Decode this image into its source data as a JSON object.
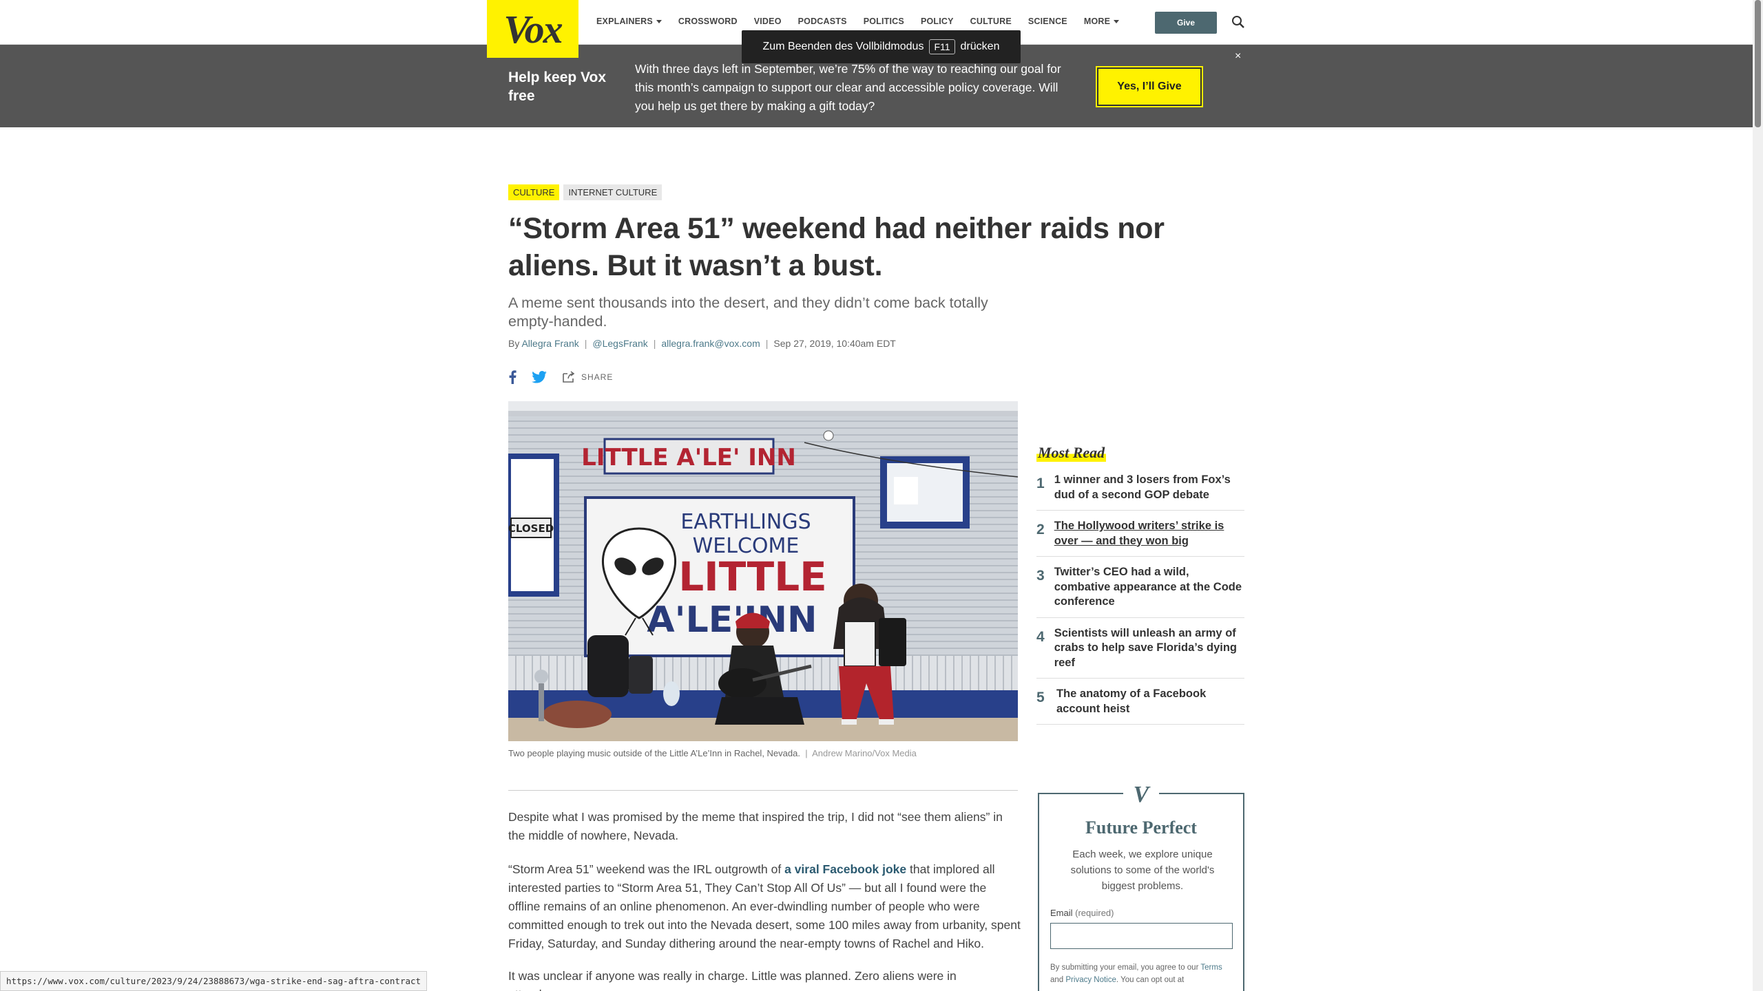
{
  "logo": "Vox",
  "nav": {
    "items": [
      {
        "label": "EXPLAINERS",
        "has_caret": true
      },
      {
        "label": "CROSSWORD",
        "has_caret": false
      },
      {
        "label": "VIDEO",
        "has_caret": false
      },
      {
        "label": "PODCASTS",
        "has_caret": false
      },
      {
        "label": "POLITICS",
        "has_caret": false
      },
      {
        "label": "POLICY",
        "has_caret": false
      },
      {
        "label": "CULTURE",
        "has_caret": false
      },
      {
        "label": "SCIENCE",
        "has_caret": false
      },
      {
        "label": "MORE",
        "has_caret": true
      }
    ],
    "give_label": "Give"
  },
  "fullscreen_notice": {
    "before": "Zum Beenden des Vollbildmodus",
    "key": "F11",
    "after": "drücken"
  },
  "banner": {
    "title": "Help keep Vox free",
    "text": "With three days left in September, we’re 75% of the way to reaching our goal for this month’s campaign to support our clear and accessible policy coverage. Will you help us get there by making a gift today?",
    "button": "Yes, I’ll Give",
    "close": "×"
  },
  "article": {
    "tags": [
      "CULTURE",
      "INTERNET CULTURE"
    ],
    "headline": "“Storm Area 51” weekend had neither raids nor aliens. But it wasn’t a bust.",
    "dek": "A meme sent thousands into the desert, and they didn’t come back totally empty-handed.",
    "byline": {
      "by": "By",
      "author": "Allegra Frank",
      "twitter": "@LegsFrank",
      "email": "allegra.frank@vox.com",
      "date": "Sep 27, 2019, 10:40am EDT"
    },
    "share_label": "SHARE",
    "image_sign": {
      "top": "LITTLE A'LE' INN",
      "line1": "EARTHLINGS",
      "line2": "WELCOME",
      "line3": "LITTLE",
      "line4": "A'LE'INN",
      "closed": "CLOSED"
    },
    "caption": "Two people playing music outside of the Little A’Le’Inn in Rachel, Nevada.",
    "credit": "Andrew Marino/Vox Media",
    "paragraphs": {
      "p1": "Despite what I was promised by the meme that inspired the trip, I did not “see them aliens” in the middle of nowhere, Nevada.",
      "p2_before": "“Storm Area 51” weekend was the IRL outgrowth of ",
      "p2_link": "a viral Facebook joke",
      "p2_after": " that implored all interested parties to “Storm Area 51, They Can’t Stop All Of Us” — but all I found were the offline remains of an online phenomenon. An ever-dwindling number of people who were committed enough to trek out into the Nevada desert, some 100 miles away from urbanity, spent Friday, Saturday, and Sunday dithering around the near-empty towns of Rachel and Hiko.",
      "p3": "It was unclear if anyone was really in charge. Little was planned. Zero aliens were in attendance."
    }
  },
  "most_read": {
    "title": "Most Read",
    "items": [
      {
        "num": "1",
        "text": "1 winner and 3 losers from Fox’s dud of a second GOP debate"
      },
      {
        "num": "2",
        "text": "The Hollywood writers’ strike is over — and they won big"
      },
      {
        "num": "3",
        "text": "Twitter’s CEO had a wild, combative appearance at the Code conference"
      },
      {
        "num": "4",
        "text": "Scientists will unleash an army of crabs to help save Florida’s dying reef"
      },
      {
        "num": "5",
        "text": "The anatomy of a Facebook account heist"
      }
    ]
  },
  "newsletter": {
    "logo": "V",
    "title": "Future Perfect",
    "desc": "Each week, we explore unique solutions to some of the world's biggest problems.",
    "email_label": "Email",
    "required": "(required)",
    "fine_a": "By submitting your email, you agree to our ",
    "terms": "Terms",
    "fine_b": " and ",
    "privacy": "Privacy Notice",
    "fine_c": ". You can opt out at"
  },
  "status_url": "https://www.vox.com/culture/2023/9/24/23888673/wga-strike-end-sag-aftra-contract",
  "colors": {
    "yellow": "#fff200",
    "slate": "#4d6870",
    "banner": "#555555"
  }
}
